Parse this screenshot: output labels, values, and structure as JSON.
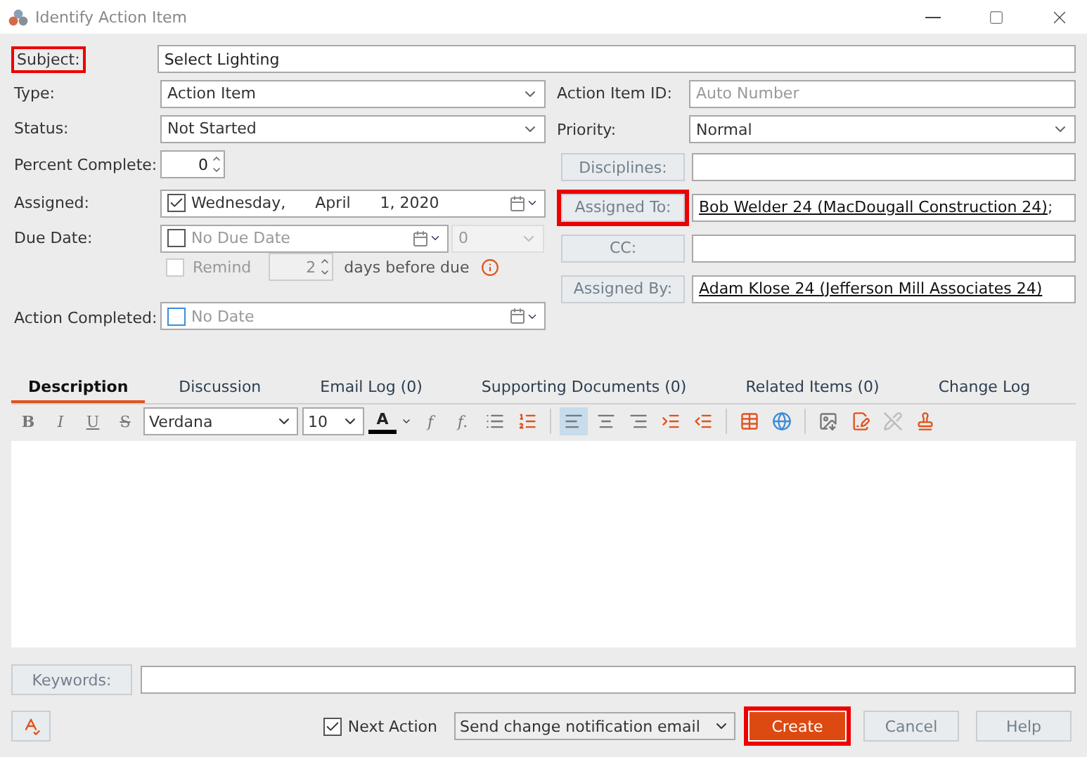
{
  "window": {
    "title": "Identify Action Item"
  },
  "subject": {
    "label": "Subject:",
    "value": "Select Lighting",
    "highlighted": true
  },
  "left_fields": [
    {
      "kind": "dropdown",
      "label": "Type:",
      "value": "Action Item"
    },
    {
      "kind": "dropdown",
      "label": "Status:",
      "value": "Not Started"
    },
    {
      "kind": "spinner",
      "label": "Percent Complete:",
      "value": "0"
    },
    {
      "kind": "date",
      "label": "Assigned:",
      "checked": true,
      "parts": [
        "Wednesday,",
        "April",
        "1, 2020"
      ]
    },
    {
      "kind": "due",
      "label": "Due Date:",
      "checked": false,
      "placeholder": "No Due Date",
      "value": "0"
    },
    {
      "kind": "remind",
      "text": "Remind",
      "checked": false,
      "value": "2",
      "suffix": "days before due"
    },
    {
      "kind": "date",
      "label": "Action Completed:",
      "checked": false,
      "placeholder": "No Date"
    }
  ],
  "right_fields": [
    {
      "kind": "text",
      "label": "Action Item ID:",
      "placeholder": "Auto Number"
    },
    {
      "kind": "dropdown",
      "label": "Priority:",
      "value": "Normal"
    },
    {
      "kind": "picker",
      "label": "Disciplines:",
      "highlighted": false
    },
    {
      "kind": "picker",
      "label": "Assigned To:",
      "link": "Bob Welder 24 (MacDougall Construction 24)",
      "suffix": ";",
      "highlighted": true
    },
    {
      "kind": "picker",
      "label": "CC:",
      "highlighted": false
    },
    {
      "kind": "picker",
      "label": "Assigned By:",
      "link": "Adam Klose 24 (Jefferson Mill Associates 24)",
      "highlighted": false
    }
  ],
  "tabs": [
    {
      "label": "Description",
      "selected": true
    },
    {
      "label": "Discussion",
      "selected": false
    },
    {
      "label": "Email Log (0)",
      "selected": false
    },
    {
      "label": "Supporting Documents (0)",
      "selected": false
    },
    {
      "label": "Related Items (0)",
      "selected": false
    },
    {
      "label": "Change Log",
      "selected": false
    }
  ],
  "toolbar": {
    "format_buttons": [
      {
        "label": "B"
      },
      {
        "label": "I"
      },
      {
        "label": "U"
      },
      {
        "label": "S"
      }
    ],
    "font": "Verdana",
    "size": "10",
    "color_button": "A",
    "script_buttons": [
      {
        "label": "f"
      },
      {
        "label": "f."
      }
    ],
    "alignments": [
      {
        "selected": true
      },
      {
        "selected": false
      },
      {
        "selected": false
      }
    ]
  },
  "keywords": {
    "label": "Keywords:"
  },
  "footer": {
    "next_action": {
      "label": "Next Action",
      "checked": true
    },
    "notification": "Send change notification email",
    "buttons": [
      {
        "label": "Create",
        "kind": "primary",
        "highlighted": true
      },
      {
        "label": "Cancel",
        "kind": "normal",
        "highlighted": false
      },
      {
        "label": "Help",
        "kind": "normal",
        "highlighted": false
      }
    ]
  }
}
